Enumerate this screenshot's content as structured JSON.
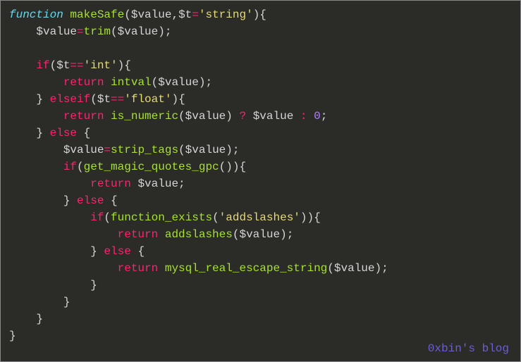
{
  "code": {
    "l1": {
      "kw_function": "function",
      "fname": "makeSafe",
      "p1": "$value",
      "p2": "$t",
      "op_eq": "=",
      "s_string": "'string'"
    },
    "l2": {
      "v": "$value",
      "op_eq": "=",
      "fn_trim": "trim",
      "arg": "$value"
    },
    "l3": {
      "kw_if": "if",
      "v": "$t",
      "op_eq": "==",
      "s_int": "'int'"
    },
    "l4": {
      "kw_return": "return",
      "fn_intval": "intval",
      "arg": "$value"
    },
    "l5": {
      "kw_elseif": "elseif",
      "v": "$t",
      "op_eq": "==",
      "s_float": "'float'"
    },
    "l6": {
      "kw_return": "return",
      "fn_isnum": "is_numeric",
      "arg": "$value",
      "q": "?",
      "v2": "$value",
      "colon": ":",
      "zero": "0"
    },
    "l7": {
      "kw_else": "else"
    },
    "l8": {
      "v": "$value",
      "op_eq": "=",
      "fn_strip": "strip_tags",
      "arg": "$value"
    },
    "l9": {
      "kw_if": "if",
      "fn_magic": "get_magic_quotes_gpc"
    },
    "l10": {
      "kw_return": "return",
      "v": "$value"
    },
    "l11": {
      "kw_else": "else"
    },
    "l12": {
      "kw_if": "if",
      "fn_exists": "function_exists",
      "s_add": "'addslashes'"
    },
    "l13": {
      "kw_return": "return",
      "fn_add": "addslashes",
      "arg": "$value"
    },
    "l14": {
      "kw_else": "else"
    },
    "l15": {
      "kw_return": "return",
      "fn_mysql": "mysql_real_escape_string",
      "arg": "$value"
    },
    "close_brace": "}",
    "open_brace": "{",
    "semi": ";",
    "comma": ",",
    "lparen": "(",
    "rparen": ")"
  },
  "watermark": "0xbin's blog"
}
